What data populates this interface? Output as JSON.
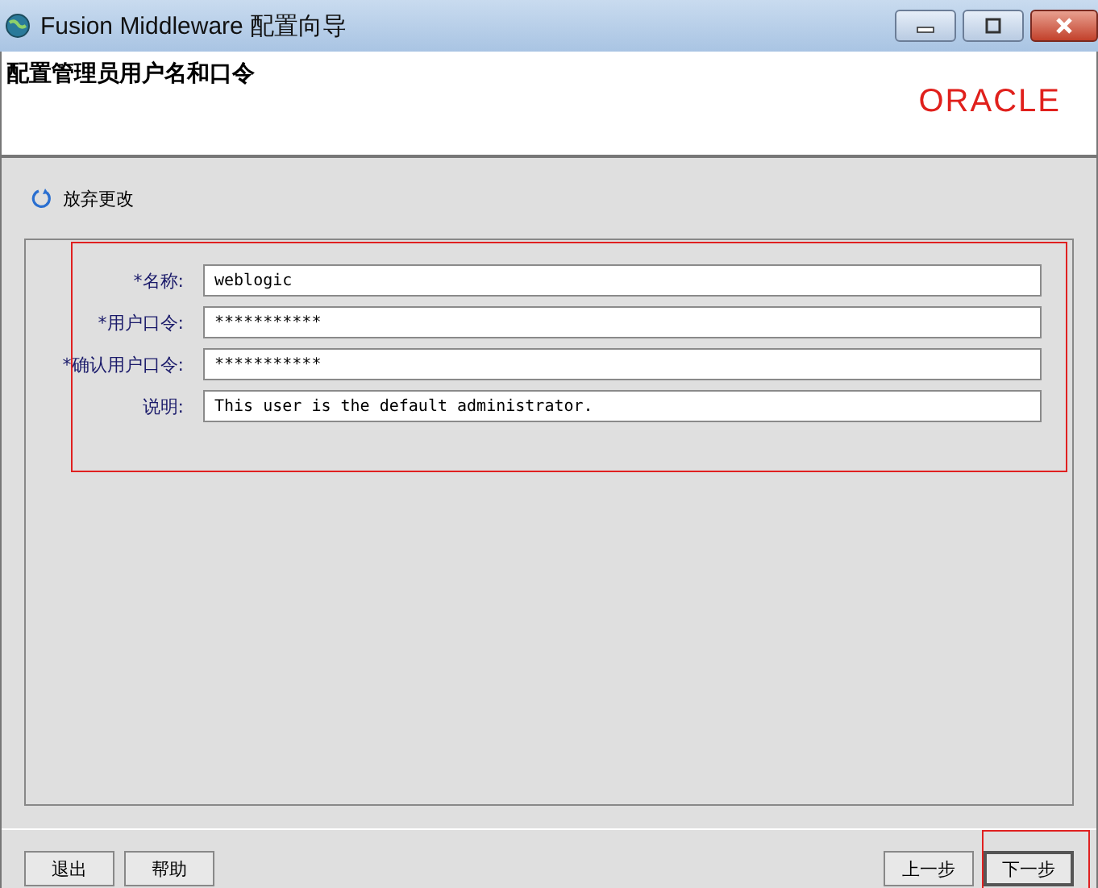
{
  "window": {
    "title": "Fusion Middleware 配置向导"
  },
  "header": {
    "title": "配置管理员用户名和口令",
    "logo": "ORACLE"
  },
  "revert_link": "放弃更改",
  "fields": [
    {
      "label": "*名称:",
      "value": "weblogic"
    },
    {
      "label": "*用户口令:",
      "value": "***********"
    },
    {
      "label": "*确认用户口令:",
      "value": "***********"
    },
    {
      "label": "说明:",
      "value": "This user is the default administrator."
    }
  ],
  "buttons_left": [
    "退出",
    "帮助"
  ],
  "buttons_right": [
    {
      "label": "上一步",
      "selected": false
    },
    {
      "label": "下一步",
      "selected": true
    }
  ]
}
